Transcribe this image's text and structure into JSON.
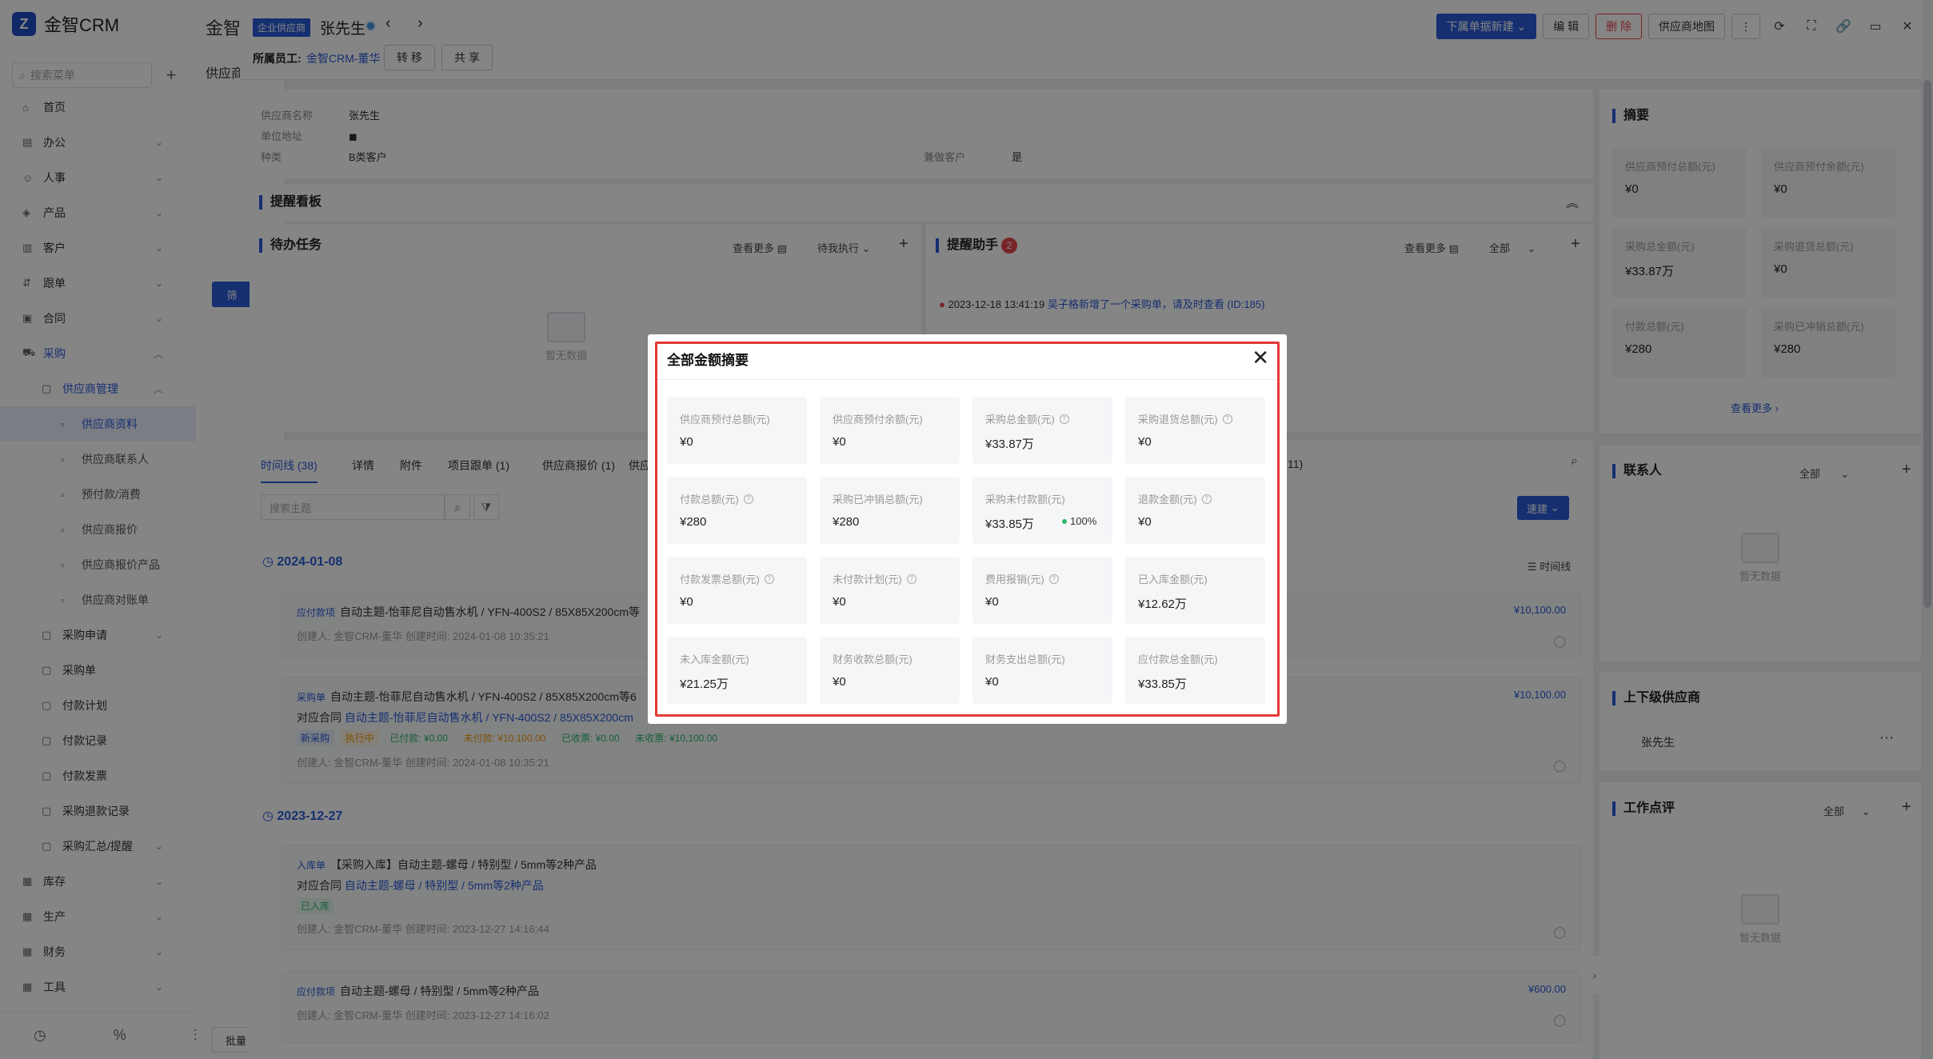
{
  "app": {
    "logo_text": "金智CRM",
    "search_placeholder": "搜索菜单"
  },
  "sidebar": {
    "items": [
      {
        "label": "首页",
        "icon": "home-icon"
      },
      {
        "label": "办公",
        "icon": "office-icon"
      },
      {
        "label": "人事",
        "icon": "people-icon"
      },
      {
        "label": "产品",
        "icon": "product-icon"
      },
      {
        "label": "客户",
        "icon": "customer-icon"
      },
      {
        "label": "跟单",
        "icon": "follow-icon"
      },
      {
        "label": "合同",
        "icon": "contract-icon"
      },
      {
        "label": "采购",
        "icon": "purchase-icon"
      }
    ],
    "supplier_mgmt": "供应商管理",
    "sub_items": [
      "供应商资料",
      "供应商联系人",
      "预付款/消费",
      "供应商报价",
      "供应商报价产品",
      "供应商对账单"
    ],
    "purchase_items": [
      "采购申请",
      "采购单",
      "付款计划",
      "付款记录",
      "付款发票",
      "采购退款记录",
      "采购汇总/提醒"
    ],
    "bottom_items": [
      {
        "label": "库存",
        "icon": "inventory-icon"
      },
      {
        "label": "生产",
        "icon": "production-icon"
      },
      {
        "label": "财务",
        "icon": "finance-icon"
      },
      {
        "label": "工具",
        "icon": "tools-icon"
      }
    ]
  },
  "col2": {
    "title": "金智",
    "subtitle": "供应商",
    "btn": "筛",
    "bottom_btn": "批量"
  },
  "header": {
    "tag": "企业供应商",
    "name": "张先生",
    "owner_label": "所属员工:",
    "owner_value": "金智CRM-董华",
    "transfer": "转 移",
    "share": "共 享",
    "new_btn": "下属单据新建",
    "edit_btn": "编 辑",
    "delete_btn": "删 除",
    "map_btn": "供应商地图"
  },
  "info": {
    "name_label": "供应商名称",
    "name_value": "张先生",
    "addr_label": "单位地址",
    "type_label": "种类",
    "type_value": "B类客户",
    "dual_label": "兼做客户",
    "dual_value": "是"
  },
  "reminder": {
    "title": "提醒看板"
  },
  "todo": {
    "title": "待办任务",
    "more": "查看更多",
    "filter": "待我执行",
    "empty": "暂无数据"
  },
  "assist": {
    "title": "提醒助手",
    "badge": "2",
    "more": "查看更多",
    "filter": "全部",
    "line1_time": "2023-12-18 13:41:19",
    "line1_text": "吴子格新增了一个采购单，请及时查看 (ID:185)"
  },
  "tabs": {
    "items": [
      "时间线 (38)",
      "详情",
      "附件",
      "项目跟单 (1)",
      "供应商报价 (1)",
      "供应"
    ],
    "tail": "11)",
    "search_placeholder": "搜索主题",
    "quick_btn": "速建",
    "timeline_label": "时间线"
  },
  "timeline": {
    "date1": "2024-01-08",
    "date2": "2023-12-27",
    "cards": [
      {
        "tag": "应付款项",
        "title": "自动主题-怡菲尼自动售水机 / YFN-400S2 / 85X85X200cm等",
        "meta": "创建人: 金智CRM-董华     创建时间: 2024-01-08 10:35:21",
        "amount": "¥10,100.00"
      },
      {
        "tag": "采购单",
        "title": "自动主题-怡菲尼自动售水机 / YFN-400S2 / 85X85X200cm等6",
        "contract_label": "对应合同",
        "contract": "自动主题-怡菲尼自动售水机 / YFN-400S2 / 85X85X200cm",
        "statuses": [
          "新采购",
          "执行中",
          "已付款: ¥0.00",
          "未付款: ¥10,100.00",
          "已收票: ¥0.00",
          "未收票: ¥10,100.00"
        ],
        "meta": "创建人: 金智CRM-董华     创建时间: 2024-01-08 10:35:21",
        "amount": "¥10,100.00"
      },
      {
        "tag": "入库单",
        "title": "【采购入库】自动主题-螺母 / 特别型 / 5mm等2种产品",
        "contract_label": "对应合同",
        "contract": "自动主题-螺母 / 特别型 / 5mm等2种产品",
        "statuses": [
          "已入库"
        ],
        "meta": "创建人: 金智CRM-董华     创建时间: 2023-12-27 14:16:44"
      },
      {
        "tag": "应付款项",
        "title": "自动主题-螺母 / 特别型 / 5mm等2种产品",
        "meta": "创建人: 金智CRM-董华     创建时间: 2023-12-27 14:16:02",
        "amount": "¥600.00"
      }
    ]
  },
  "right": {
    "summary_title": "摘要",
    "summary": [
      {
        "label": "供应商预付总额(元)",
        "value": "¥0"
      },
      {
        "label": "供应商预付余额(元)",
        "value": "¥0"
      },
      {
        "label": "采购总金额(元)",
        "value": "¥33.87万"
      },
      {
        "label": "采购退货总额(元)",
        "value": "¥0"
      },
      {
        "label": "付款总额(元)",
        "value": "¥280"
      },
      {
        "label": "采购已冲销总额(元)",
        "value": "¥280"
      }
    ],
    "summary_more": "查看更多",
    "contacts_title": "联系人",
    "contacts_filter": "全部",
    "contacts_empty": "暂无数据",
    "parent_title": "上下级供应商",
    "parent_item": "张先生",
    "review_title": "工作点评",
    "review_filter": "全部",
    "review_empty": "暂无数据"
  },
  "modal": {
    "title": "全部金额摘要",
    "cells": [
      {
        "label": "供应商预付总额(元)",
        "value": "¥0",
        "help": false
      },
      {
        "label": "供应商预付余额(元)",
        "value": "¥0",
        "help": false
      },
      {
        "label": "采购总金额(元)",
        "value": "¥33.87万",
        "help": true
      },
      {
        "label": "采购退货总额(元)",
        "value": "¥0",
        "help": true
      },
      {
        "label": "付款总额(元)",
        "value": "¥280",
        "help": true
      },
      {
        "label": "采购已冲销总额(元)",
        "value": "¥280",
        "help": false
      },
      {
        "label": "采购未付款额(元)",
        "value": "¥33.85万",
        "help": false,
        "percent": "100%"
      },
      {
        "label": "退款金额(元)",
        "value": "¥0",
        "help": true
      },
      {
        "label": "付款发票总额(元)",
        "value": "¥0",
        "help": true
      },
      {
        "label": "未付款计划(元)",
        "value": "¥0",
        "help": true
      },
      {
        "label": "费用报销(元)",
        "value": "¥0",
        "help": true
      },
      {
        "label": "已入库金额(元)",
        "value": "¥12.62万",
        "help": false
      },
      {
        "label": "未入库金额(元)",
        "value": "¥21.25万",
        "help": false
      },
      {
        "label": "财务收款总额(元)",
        "value": "¥0",
        "help": false
      },
      {
        "label": "财务支出总额(元)",
        "value": "¥0",
        "help": false
      },
      {
        "label": "应付款总金额(元)",
        "value": "¥33.85万",
        "help": false
      }
    ]
  },
  "colors": {
    "primary": "#2a5bd7",
    "danger": "#e5484d",
    "highlight": "#e53935"
  }
}
